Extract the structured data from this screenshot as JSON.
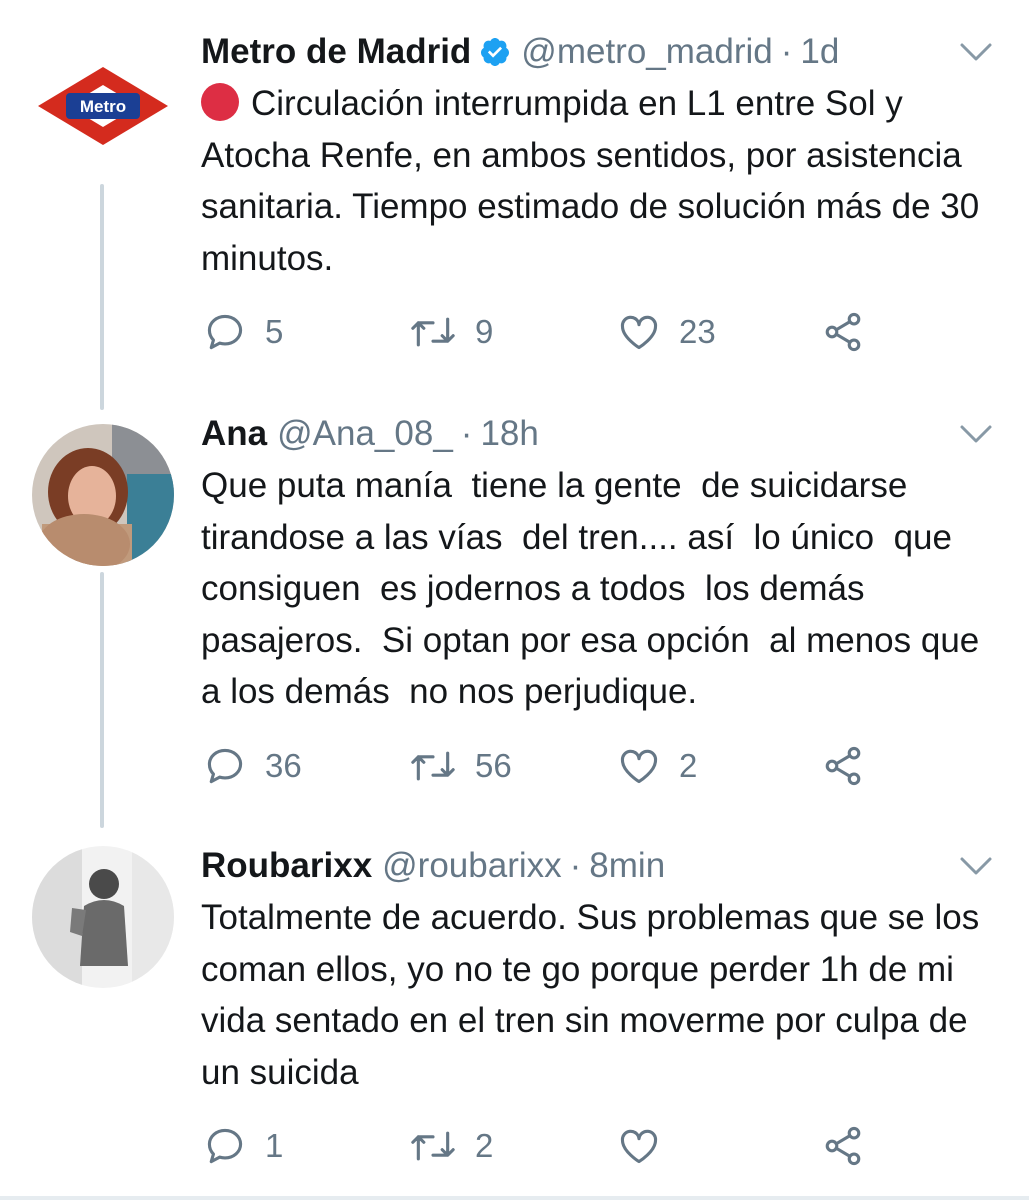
{
  "tweets": [
    {
      "name": "Metro de Madrid",
      "verified": true,
      "handle": "@metro_madrid",
      "time": "1d",
      "avatar_logo_text": "Metro",
      "status_emoji": "red-circle",
      "text": "Circulación interrumpida en L1 entre Sol y Atocha Renfe, en ambos sentidos, por asistencia sanitaria. Tiempo estimado de solución más de 30 minutos.",
      "replies": "5",
      "retweets": "9",
      "likes": "23"
    },
    {
      "name": "Ana",
      "verified": false,
      "handle": "@Ana_08_",
      "time": "18h",
      "text": "Que puta manía  tiene la gente  de suicidarse tirandose a las vías  del tren.... así  lo único  que  consiguen  es jodernos a todos  los demás pasajeros.  Si optan por esa opción  al menos que  a los demás  no nos perjudique.",
      "replies": "36",
      "retweets": "56",
      "likes": "2"
    },
    {
      "name": "Roubarixx",
      "verified": false,
      "handle": "@roubarixx",
      "time": "8min",
      "text": "Totalmente de acuerdo. Sus problemas que se los coman ellos, yo no te go porque perder 1h de mi vida sentado en el tren sin moverme por culpa de un suicida",
      "replies": "1",
      "retweets": "2",
      "likes": ""
    }
  ],
  "separator": "·",
  "icons": {
    "verified": "verified-badge-icon",
    "caret": "chevron-down-icon",
    "reply": "reply-icon",
    "retweet": "retweet-icon",
    "like": "heart-icon",
    "share": "share-icon"
  },
  "colors": {
    "text": "#14171a",
    "secondary": "#657786",
    "verified": "#1da1f2",
    "thread_line": "#ccd6dd",
    "red_circle": "#dd2e44",
    "metro_red": "#d42b1e",
    "metro_blue": "#1b3f94"
  }
}
